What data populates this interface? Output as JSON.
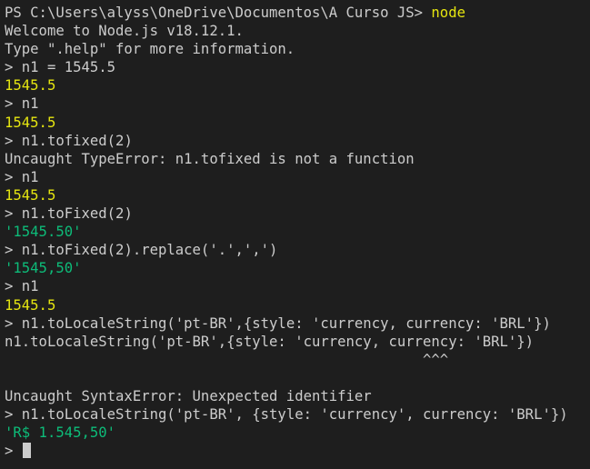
{
  "terminal": {
    "header": {
      "path_prompt": "PS C:\\Users\\alyss\\OneDrive\\Documentos\\A Curso JS> ",
      "command": "node"
    },
    "welcome": "Welcome to Node.js v18.12.1.",
    "help_hint": "Type \".help\" for more information.",
    "prompt_symbol": "> ",
    "entries": [
      {
        "kind": "input",
        "text": "n1 = 1545.5"
      },
      {
        "kind": "num",
        "text": "1545.5"
      },
      {
        "kind": "input",
        "text": "n1"
      },
      {
        "kind": "num",
        "text": "1545.5"
      },
      {
        "kind": "input",
        "text": "n1.tofixed(2)"
      },
      {
        "kind": "err",
        "text": "Uncaught TypeError: n1.tofixed is not a function"
      },
      {
        "kind": "input",
        "text": "n1"
      },
      {
        "kind": "num",
        "text": "1545.5"
      },
      {
        "kind": "input",
        "text": "n1.toFixed(2)"
      },
      {
        "kind": "str",
        "text": "'1545.50'"
      },
      {
        "kind": "input",
        "text": "n1.toFixed(2).replace('.',',')"
      },
      {
        "kind": "str",
        "text": "'1545,50'"
      },
      {
        "kind": "input",
        "text": "n1"
      },
      {
        "kind": "num",
        "text": "1545.5"
      },
      {
        "kind": "input",
        "text": "n1.toLocaleString('pt-BR',{style: 'currency, currency: 'BRL'})"
      },
      {
        "kind": "plain",
        "text": "n1.toLocaleString('pt-BR',{style: 'currency, currency: 'BRL'})"
      },
      {
        "kind": "plain",
        "text": "                                                 ^^^"
      },
      {
        "kind": "plain",
        "text": ""
      },
      {
        "kind": "err",
        "text": "Uncaught SyntaxError: Unexpected identifier"
      },
      {
        "kind": "input",
        "text": "n1.toLocaleString('pt-BR', {style: 'currency', currency: 'BRL'})"
      },
      {
        "kind": "str",
        "text": "'R$ 1.545,50'"
      }
    ]
  },
  "colors": {
    "background": "#1e1e1e",
    "foreground": "#cccccc",
    "number": "#e5e510",
    "string": "#0dbc79"
  }
}
